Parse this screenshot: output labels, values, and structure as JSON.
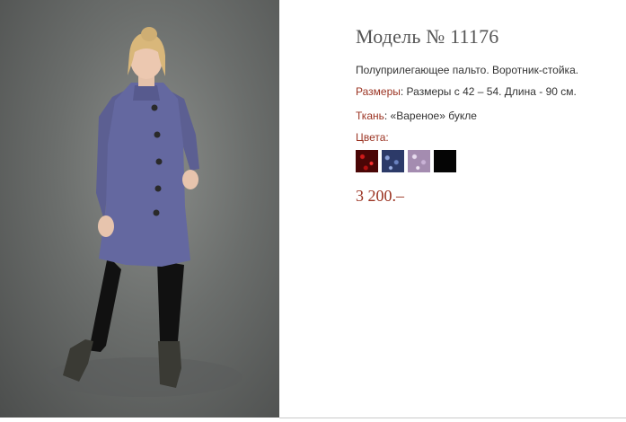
{
  "product": {
    "title": "Модель № 11176",
    "description": "Полуприлегающее пальто. Воротник-стойка.",
    "sizes_label": "Размеры",
    "sizes_value": ": Размеры с 42 – 54. Длина - 90 см.",
    "fabric_label": "Ткань",
    "fabric_value": ": «Вареное» букле",
    "colors_label": "Цвета:",
    "colors": [
      {
        "name": "red-boucle",
        "hex": "#8b0d0d"
      },
      {
        "name": "blue-boucle",
        "hex": "#3a4a80"
      },
      {
        "name": "lilac-boucle",
        "hex": "#b8a0c4"
      },
      {
        "name": "black",
        "hex": "#050505"
      }
    ],
    "price": "3 200.–"
  }
}
